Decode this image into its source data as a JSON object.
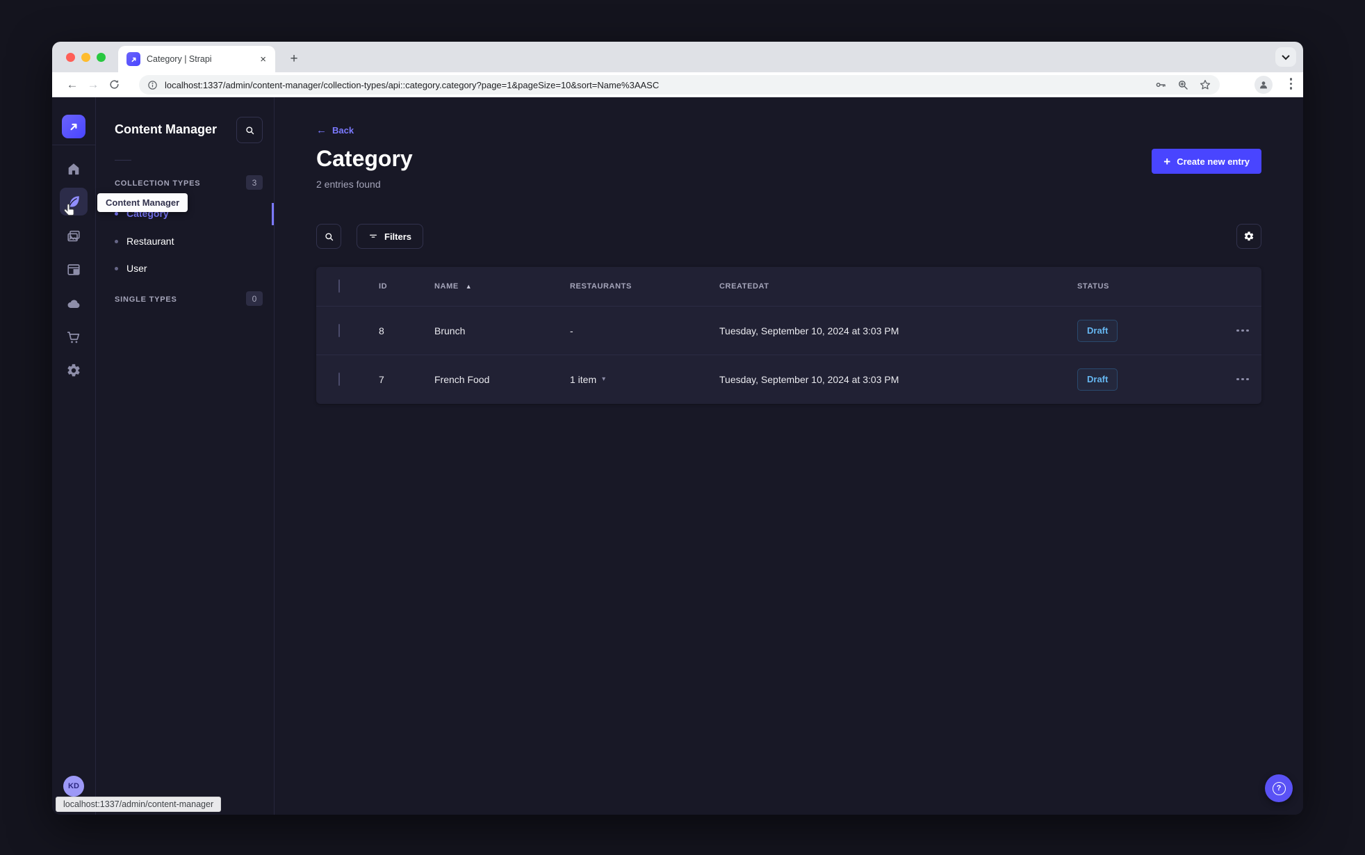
{
  "browser": {
    "tab_title": "Category | Strapi",
    "url": "localhost:1337/admin/content-manager/collection-types/api::category.category?page=1&pageSize=10&sort=Name%3AASC",
    "status_link_preview": "localhost:1337/admin/content-manager"
  },
  "icons": {
    "back_arrow": "←",
    "forward_arrow": "→",
    "close": "×",
    "new_tab": "+",
    "plus": "+",
    "sort_asc": "▲",
    "caret_down": "▾",
    "question_mark": "?"
  },
  "sidebar": {
    "avatar_initials": "KD",
    "tooltip": "Content Manager"
  },
  "subnav": {
    "title": "Content Manager",
    "collection_types": {
      "label": "COLLECTION TYPES",
      "count": "3",
      "items": [
        {
          "label": "Category",
          "active": true
        },
        {
          "label": "Restaurant",
          "active": false
        },
        {
          "label": "User",
          "active": false
        }
      ]
    },
    "single_types": {
      "label": "SINGLE TYPES",
      "count": "0"
    }
  },
  "main": {
    "back_label": "Back",
    "title": "Category",
    "entries_count": "2 entries found",
    "create_button_label": "Create new entry",
    "filters_button_label": "Filters",
    "table": {
      "columns": [
        "ID",
        "NAME",
        "RESTAURANTS",
        "CREATEDAT",
        "STATUS"
      ],
      "rows": [
        {
          "id": "8",
          "name": "Brunch",
          "restaurants": "-",
          "created_at": "Tuesday, September 10, 2024 at 3:03 PM",
          "status": "Draft"
        },
        {
          "id": "7",
          "name": "French Food",
          "restaurants": "1 item",
          "created_at": "Tuesday, September 10, 2024 at 3:03 PM",
          "status": "Draft"
        }
      ]
    }
  },
  "colors": {
    "accent": "#4945ff",
    "link": "#7b79ff",
    "app_background": "#181826",
    "card_background": "#212134",
    "border": "#32324d",
    "muted_text": "#a5a5ba",
    "draft_text": "#66b7f1",
    "status_draft_border": "#2a4a6e"
  }
}
